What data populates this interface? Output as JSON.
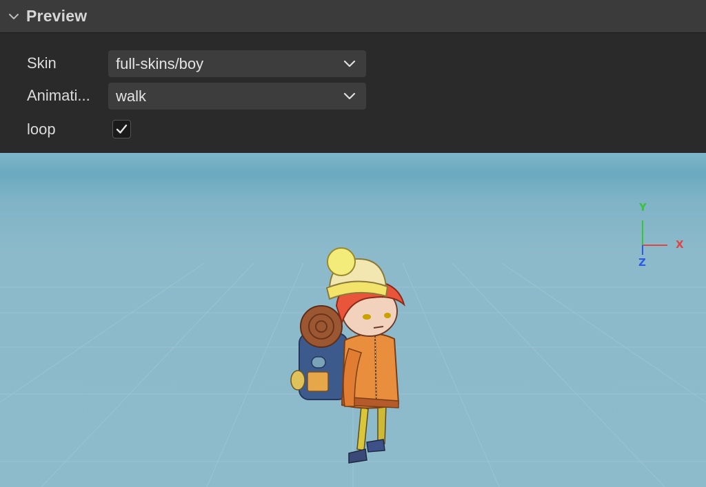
{
  "panel": {
    "title": "Preview"
  },
  "properties": {
    "skin": {
      "label": "Skin",
      "value": "full-skins/boy"
    },
    "animation": {
      "label": "Animati...",
      "value": "walk"
    },
    "loop": {
      "label": "loop",
      "checked": true
    }
  },
  "gizmo": {
    "y_label": "Y",
    "x_label": "X",
    "z_label": "Z",
    "y_color": "#39c439",
    "x_color": "#e04545",
    "z_color": "#2a5ae6"
  },
  "icons": {
    "collapse": "chevron-down-icon",
    "dropdown": "chevron-down-icon",
    "check": "checkmark-icon"
  }
}
